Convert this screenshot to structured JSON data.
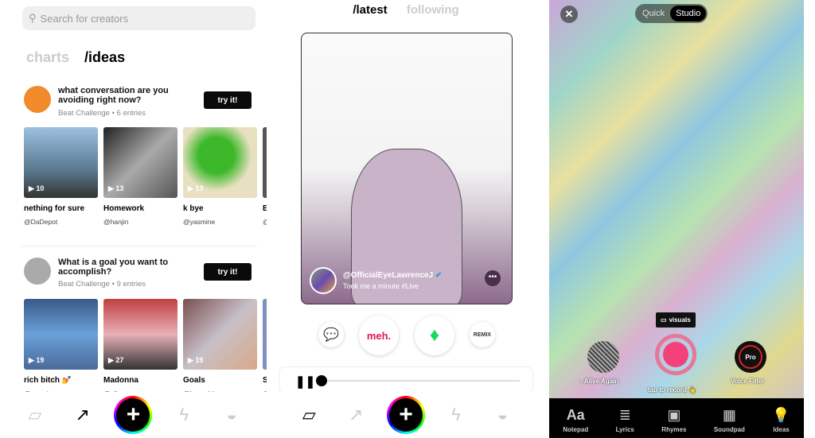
{
  "discover": {
    "search_placeholder": "Search for creators",
    "tabs": [
      {
        "label": "charts",
        "active": false
      },
      {
        "label": "/ideas",
        "active": true
      }
    ],
    "challenges": [
      {
        "title": "what conversation are you avoiding right now?",
        "meta": "Beat Challenge • 6 entries",
        "button": "try it!",
        "entries": [
          {
            "name": "nething for sure",
            "user": "@DaDepot",
            "plays": "10"
          },
          {
            "name": "Homework",
            "user": "@hanjin",
            "plays": "13"
          },
          {
            "name": "k bye",
            "user": "@yasmine",
            "plays": "13"
          },
          {
            "name": "E",
            "user": "@",
            "plays": ""
          }
        ]
      },
      {
        "title": "What is a goal you want to accomplish?",
        "meta": "Beat Challenge • 9 entries",
        "button": "try it!",
        "entries": [
          {
            "name": "rich bitch 💅",
            "user": "@yasmine",
            "plays": "19"
          },
          {
            "name": "Madonna",
            "user": "@elba",
            "plays": "27"
          },
          {
            "name": "Goals",
            "user": "@hapachita",
            "plays": "19"
          },
          {
            "name": "S",
            "user": "@",
            "plays": ""
          }
        ]
      }
    ]
  },
  "feed": {
    "tabs": [
      {
        "label": "/latest",
        "active": true
      },
      {
        "label": "following",
        "active": false
      }
    ],
    "post": {
      "handle": "@OfficialEyeLawrenceJ",
      "verified": true,
      "caption": "Took me a minute #Live"
    },
    "actions": {
      "meh": "meh.",
      "remix": "REMIX"
    },
    "progress": 0
  },
  "nav": {
    "icons": [
      "cards-icon",
      "trending-icon",
      "plus-icon",
      "lightning-icon",
      "profile-icon"
    ]
  },
  "studio": {
    "modes": [
      {
        "label": "Quick",
        "active": false
      },
      {
        "label": "Studio",
        "active": true
      }
    ],
    "visuals": "visuals",
    "song": "♪ Alive Again",
    "record_hint": "tap to record 👆",
    "voice_filter": "Voice Filter",
    "pro": "Pro",
    "tools": [
      {
        "icon": "Aa",
        "label": "Notepad"
      },
      {
        "icon": "≣",
        "label": "Lyrics"
      },
      {
        "icon": "▣",
        "label": "Rhymes"
      },
      {
        "icon": "▦",
        "label": "Soundpad"
      },
      {
        "icon": "💡",
        "label": "Ideas"
      }
    ]
  },
  "colors": {
    "accent_record": "#f4417a",
    "fire": "#1ed760",
    "meh": "#e0194f"
  }
}
